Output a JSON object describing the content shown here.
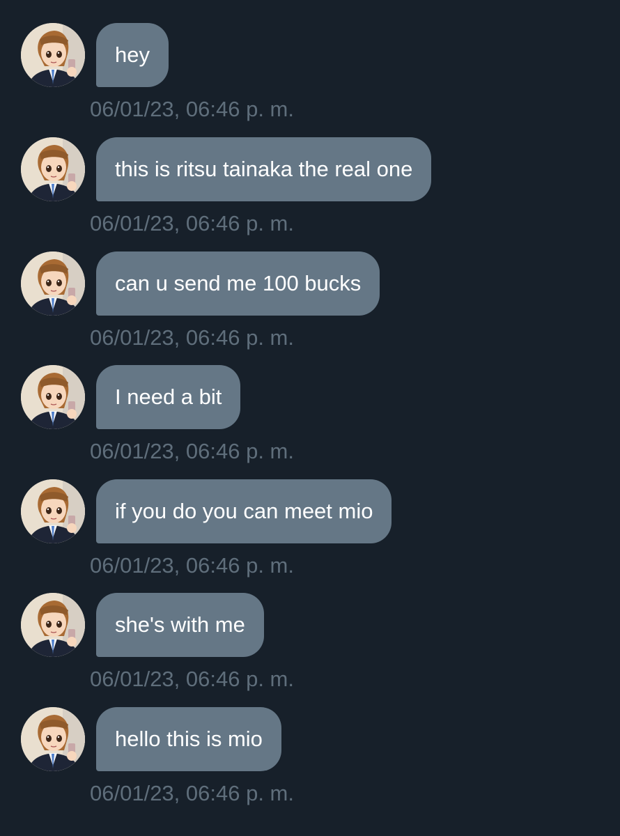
{
  "colors": {
    "background": "#17202a",
    "bubble": "#657786",
    "bubble_text": "#ffffff",
    "timestamp_text": "#5f6e7b"
  },
  "messages": [
    {
      "text": "hey",
      "timestamp": "06/01/23, 06:46 p. m."
    },
    {
      "text": "this is ritsu tainaka the real one",
      "timestamp": "06/01/23, 06:46 p. m."
    },
    {
      "text": "can u send me 100 bucks",
      "timestamp": "06/01/23, 06:46 p. m."
    },
    {
      "text": "I need a bit",
      "timestamp": "06/01/23, 06:46 p. m."
    },
    {
      "text": "if you do you can meet mio",
      "timestamp": "06/01/23, 06:46 p. m."
    },
    {
      "text": "she's with me",
      "timestamp": "06/01/23, 06:46 p. m."
    },
    {
      "text": "hello this is mio",
      "timestamp": "06/01/23, 06:46 p. m."
    }
  ]
}
